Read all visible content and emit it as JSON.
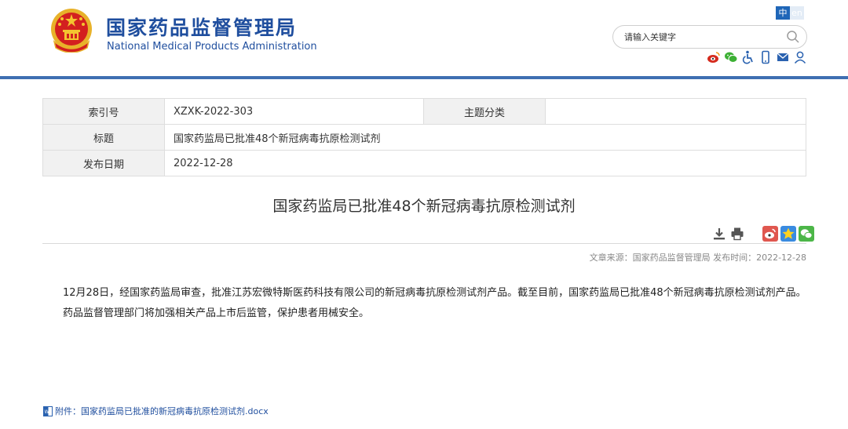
{
  "site": {
    "name_cn": "国家药品监督管理局",
    "name_en": "National Medical Products Administration"
  },
  "language": {
    "zh": "中",
    "en": "en"
  },
  "search": {
    "placeholder": "请输入关键字"
  },
  "tool_icons": [
    "weibo-icon",
    "wechat-icon",
    "accessibility-icon",
    "mobile-icon",
    "mail-icon",
    "user-icon"
  ],
  "meta": {
    "index_label": "索引号",
    "index_value": "XZXK-2022-303",
    "category_label": "主题分类",
    "category_value": "",
    "title_label": "标题",
    "title_value": "国家药监局已批准48个新冠病毒抗原检测试剂",
    "date_label": "发布日期",
    "date_value": "2022-12-28"
  },
  "article": {
    "title": "国家药监局已批准48个新冠病毒抗原检测试剂",
    "source_line": "文章来源：国家药品监督管理局 发布时间：2022-12-28",
    "paragraph": "12月28日，经国家药监局审查，批准江苏宏微特斯医药科技有限公司的新冠病毒抗原检测试剂产品。截至目前，国家药监局已批准48个新冠病毒抗原检测试剂产品。药品监督管理部门将加强相关产品上市后监管，保护患者用械安全。"
  },
  "share_icons": [
    "download-icon",
    "print-icon",
    "weibo-share-icon",
    "qzone-share-icon",
    "wechat-share-icon"
  ],
  "attachment": {
    "prefix": "附件：",
    "filename": "国家药监局已批准的新冠病毒抗原检测试剂.docx"
  },
  "colors": {
    "brand": "#1f4e9e",
    "topbar": "#3f6fb2"
  }
}
